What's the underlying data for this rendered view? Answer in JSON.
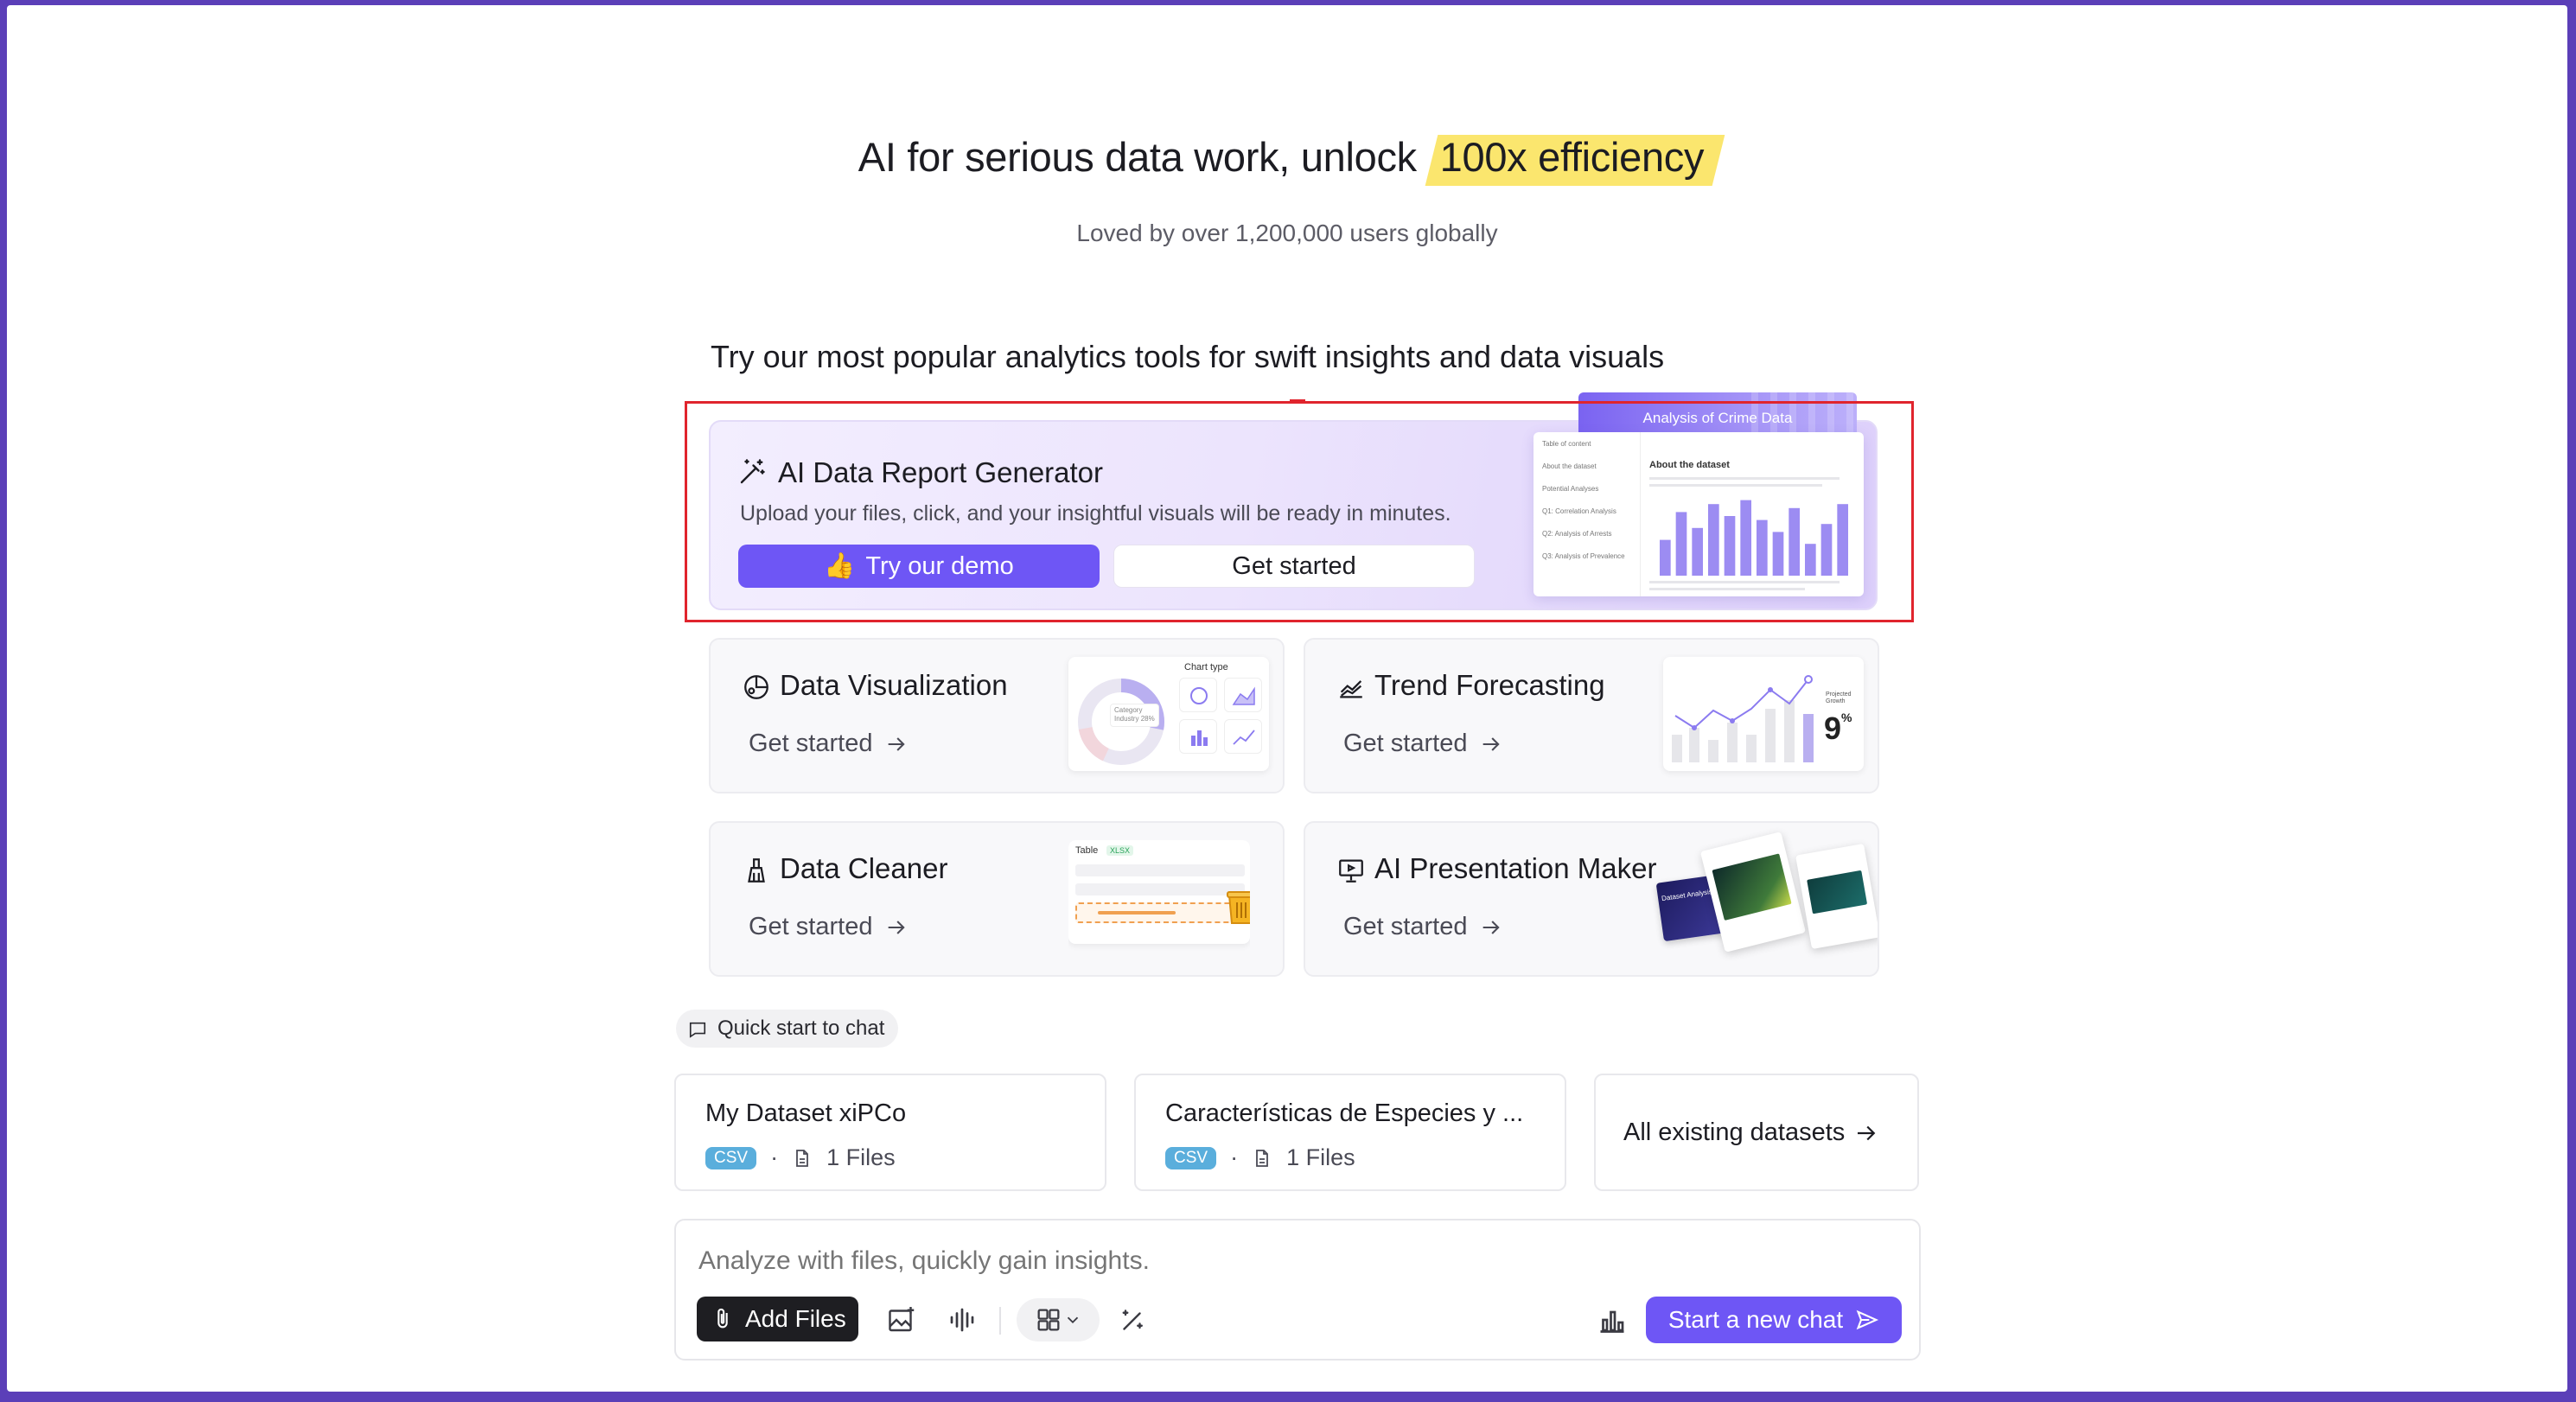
{
  "header": {
    "title_prefix": "AI for serious data work, unlock",
    "title_highlight": "100x efficiency",
    "subtitle": "Loved by over 1,200,000 users globally"
  },
  "tools_section": {
    "heading": "Try our most popular analytics tools for swift insights and data visuals"
  },
  "hero": {
    "icon": "magic-wand-icon",
    "title": "AI Data Report Generator",
    "description": "Upload your files, click, and your insightful visuals will be ready in minutes.",
    "demo_emoji": "👍",
    "demo_label": "Try our demo",
    "get_started_label": "Get started",
    "preview_tab": "Analysis of Crime Data",
    "preview_about": "About the dataset",
    "preview_toc": [
      "Table of content",
      "About the dataset",
      "Potential Analyses",
      "Q1: Correlation Analysis",
      "Q2: Analysis of Arrests",
      "Q3: Analysis of Prevalence"
    ],
    "preview_bars": [
      0.45,
      0.8,
      0.6,
      0.9,
      0.75,
      0.95,
      0.7,
      0.55,
      0.85,
      0.4,
      0.65,
      0.9
    ]
  },
  "cards": [
    {
      "title": "Data Visualization",
      "icon": "chart-palette-icon",
      "link": "Get started",
      "thumb_label": "Chart type",
      "donut_label": "Category",
      "donut_sub": "Industry",
      "donut_pct": "28%"
    },
    {
      "title": "Trend Forecasting",
      "icon": "trend-chart-icon",
      "link": "Get started",
      "thumb_label": "Projected Growth",
      "growth_value": "9"
    },
    {
      "title": "Data Cleaner",
      "icon": "broom-icon",
      "link": "Get started",
      "thumb_label": "Table",
      "thumb_badge": "XLSX"
    },
    {
      "title": "AI Presentation Maker",
      "icon": "presentation-icon",
      "link": "Get started",
      "slide_label": "Dataset Analysis"
    }
  ],
  "quick_start": {
    "label": "Quick start to chat",
    "datasets": [
      {
        "name": "My Dataset xiPCo",
        "badge": "CSV",
        "files": "1 Files"
      },
      {
        "name": "Características de Especies y ...",
        "badge": "CSV",
        "files": "1 Files"
      }
    ],
    "all_label": "All existing datasets"
  },
  "chat": {
    "placeholder": "Analyze with files, quickly gain insights.",
    "add_files": "Add Files",
    "new_chat": "Start a new chat"
  },
  "colors": {
    "brand": "#6e56f5",
    "highlight": "#fbe66e",
    "csv_badge": "#5aaedc",
    "frame": "#5b3fb8",
    "annotation": "#e0242d"
  }
}
